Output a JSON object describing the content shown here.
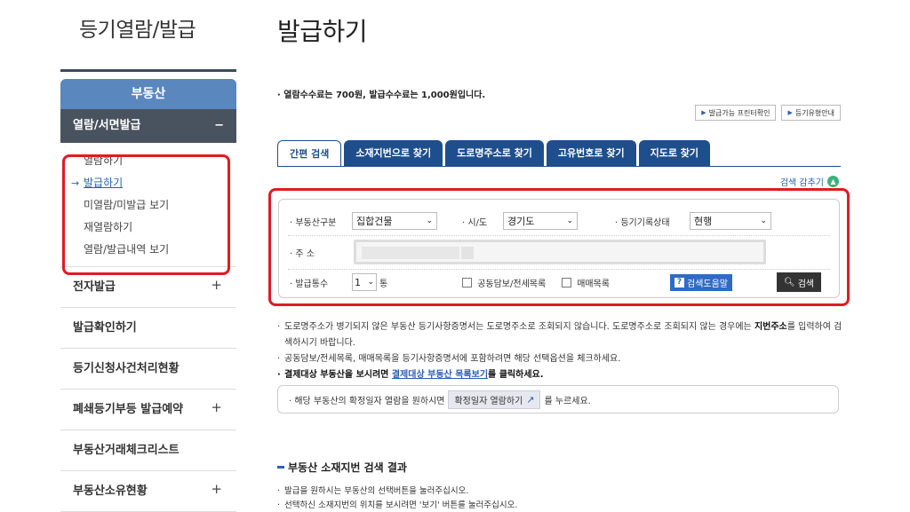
{
  "header": {
    "left_title": "등기열람/발급",
    "main_title": "발급하기"
  },
  "sidebar": {
    "category": "부동산",
    "sub_section": "열람/서면발급",
    "sub_toggle": "−",
    "sub_items": [
      {
        "label": "열람하기",
        "active": false
      },
      {
        "label": "발급하기",
        "active": true
      },
      {
        "label": "미열람/미발급 보기",
        "active": false
      },
      {
        "label": "재열람하기",
        "active": false
      },
      {
        "label": "열람/발급내역 보기",
        "active": false
      }
    ],
    "active_marker": "→",
    "menu": [
      {
        "label": "전자발급",
        "plus": "+"
      },
      {
        "label": "발급확인하기",
        "plus": ""
      },
      {
        "label": "등기신청사건처리현황",
        "plus": ""
      },
      {
        "label": "폐쇄등기부등 발급예약",
        "plus": "+"
      },
      {
        "label": "부동산거래체크리스트",
        "plus": ""
      },
      {
        "label": "부동산소유현황",
        "plus": "+"
      }
    ]
  },
  "fee_note": "· 열람수수료는 700원, 발급수수료는 1,000원입니다.",
  "top_buttons": [
    {
      "label": "발급가능 프린터확인"
    },
    {
      "label": "등기유형안내"
    }
  ],
  "tabs": [
    {
      "label": "간편 검색",
      "active": true
    },
    {
      "label": "소재지번으로 찾기",
      "active": false
    },
    {
      "label": "도로명주소로 찾기",
      "active": false
    },
    {
      "label": "고유번호로 찾기",
      "active": false
    },
    {
      "label": "지도로 찾기",
      "active": false
    }
  ],
  "hide_search_label": "검색 감추기",
  "search": {
    "type_label": "부동산구분",
    "type_value": "집합건물",
    "region_label": "시/도",
    "region_value": "경기도",
    "status_label": "등기기록상태",
    "status_value": "현행",
    "address_label": "주 소",
    "copies_label": "발급통수",
    "copies_value": "1",
    "copies_unit": "통",
    "joint_label": "공동담보/전세목록",
    "sale_label": "매매목록",
    "help_label": "검색도움말",
    "search_label": "검색"
  },
  "notes": {
    "n1a": "도로명주소가 병기되지 않은 부동산 등기사항증명서는 도로명주소로 조회되지 않습니다. 도로명주소로 조회되지 않는 경우에는 ",
    "n1b": "지번주소",
    "n1c": "를 입력하여 검색하시기 바랍니다.",
    "n2": "공동담보/전세목록, 매매목록을 등기사항증명서에 포함하려면 해당 선택옵션을 체크하세요.",
    "n3a": "결제대상 부동산을 보시려면 ",
    "n3link": "결제대상 부동산 목록보기",
    "n3b": "를 클릭하세요."
  },
  "confirm": {
    "text_before": "· 해당 부동산의 확정일자 열람을 원하시면",
    "button": "확정일자 열람하기",
    "text_after": "를 누르세요."
  },
  "result": {
    "title": "부동산 소재지번 검색 결과",
    "notes": [
      "발급을 원하시는 부동산의 선택버튼을 눌러주십시오.",
      "선택하신 소재지번의 위치를 보시려면 '보기' 버튼를 눌러주십시오."
    ]
  }
}
